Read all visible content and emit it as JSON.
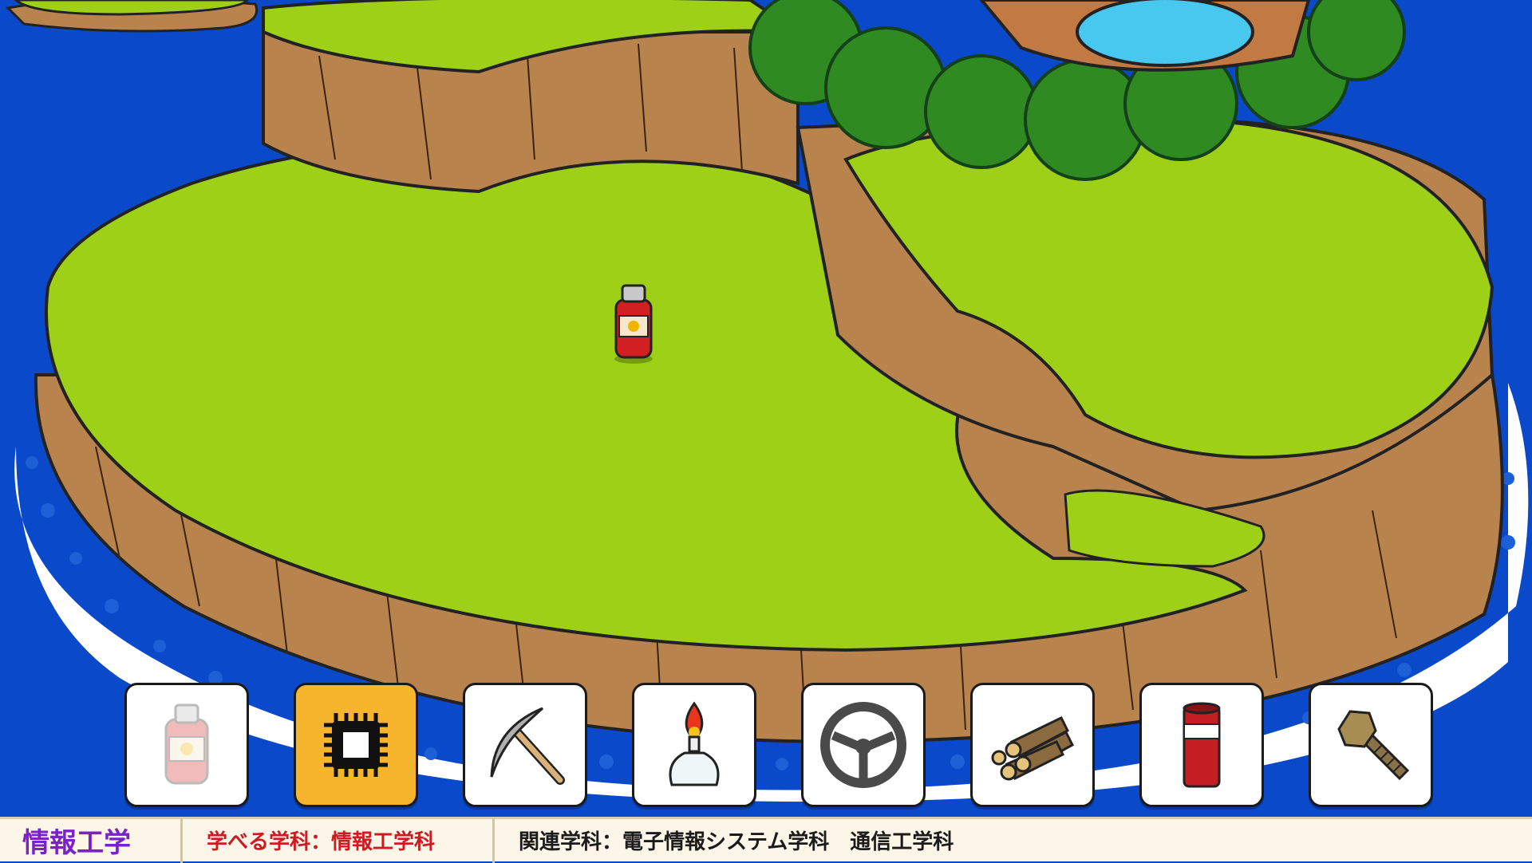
{
  "scene": {
    "colors": {
      "sea": "#0a49c9",
      "grass": "#9fd018",
      "cliff": "#b9834e",
      "foam": "#ffffff",
      "trees": "#2f8a22",
      "pond": "#48c8ef"
    },
    "map_item_icon": "fire-extinguisher-icon"
  },
  "toolbar": {
    "selected_index": 1,
    "slots": [
      {
        "icon": "fire-extinguisher-icon",
        "state": "faded"
      },
      {
        "icon": "cpu-chip-icon",
        "state": "selected"
      },
      {
        "icon": "pickaxe-icon",
        "state": "normal"
      },
      {
        "icon": "alcohol-lamp-icon",
        "state": "normal"
      },
      {
        "icon": "steering-wheel-icon",
        "state": "normal"
      },
      {
        "icon": "logs-icon",
        "state": "normal"
      },
      {
        "icon": "red-cylinder-icon",
        "state": "normal"
      },
      {
        "icon": "bolt-screw-icon",
        "state": "normal"
      }
    ]
  },
  "info": {
    "title": "情報工学",
    "learn": "学べる学科：情報工学科",
    "related": "関連学科：電子情報システム学科　通信工学科"
  }
}
